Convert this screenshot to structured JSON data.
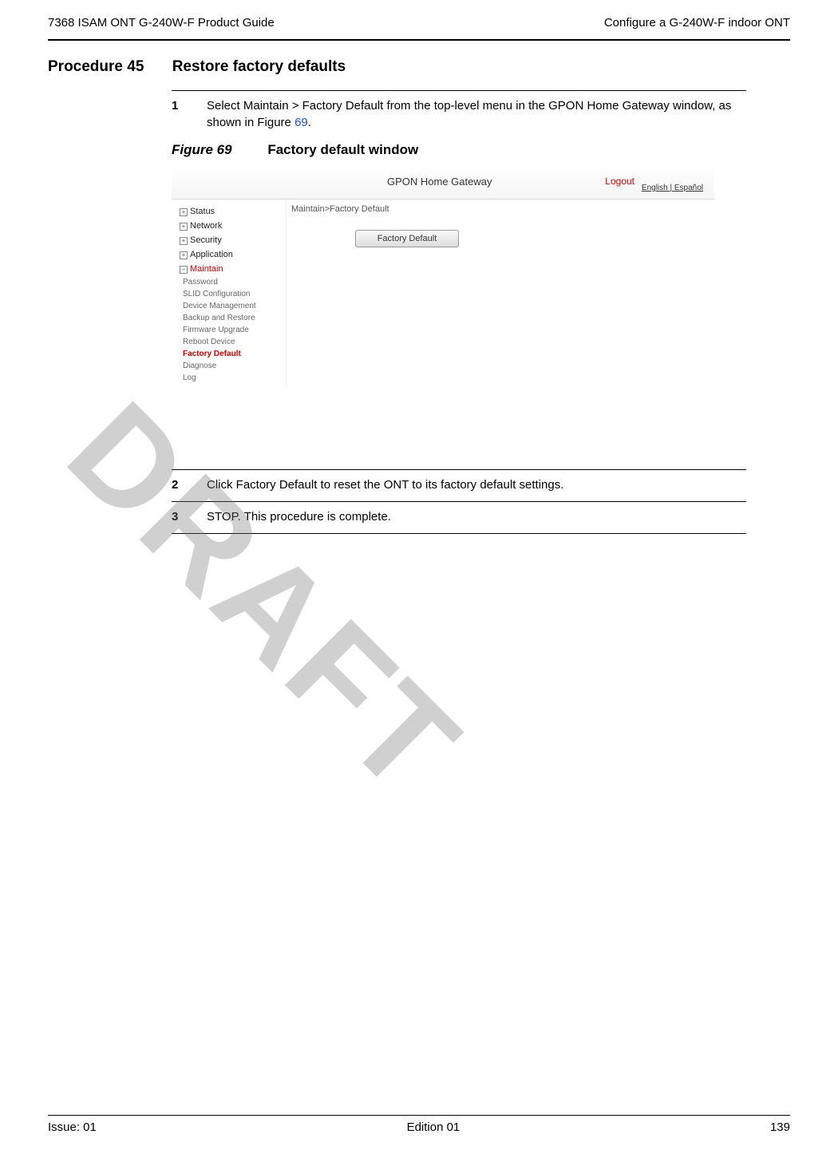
{
  "header": {
    "left": "7368 ISAM ONT G-240W-F Product Guide",
    "right": "Configure a G-240W-F indoor ONT"
  },
  "procedure": {
    "label": "Procedure 45",
    "title": "Restore factory defaults"
  },
  "steps": {
    "s1_num": "1",
    "s1_text_a": "Select Maintain > Factory Default from the top-level menu in the GPON Home Gateway window, as shown in Figure ",
    "s1_link": "69",
    "s1_text_b": ".",
    "fig_num": "Figure 69",
    "fig_text": "Factory default window",
    "s2_num": "2",
    "s2_text": "Click Factory Default to reset the ONT to its factory default settings.",
    "s3_num": "3",
    "s3_text": "STOP. This procedure is complete."
  },
  "screenshot": {
    "title": "GPON Home Gateway",
    "logout": "Logout",
    "lang": "English | Español",
    "breadcrumb": "Maintain>Factory Default",
    "button": "Factory Default",
    "cats": {
      "status": "Status",
      "network": "Network",
      "security": "Security",
      "application": "Application",
      "maintain": "Maintain"
    },
    "subs": {
      "password": "Password",
      "slid": "SLID Configuration",
      "device": "Device Management",
      "backup": "Backup and Restore",
      "firmware": "Firmware Upgrade",
      "reboot": "Reboot Device",
      "factory": "Factory Default",
      "diagnose": "Diagnose",
      "log": "Log"
    }
  },
  "watermark": "DRAFT",
  "footer": {
    "left": "Issue: 01",
    "center": "Edition 01",
    "right": "139"
  }
}
